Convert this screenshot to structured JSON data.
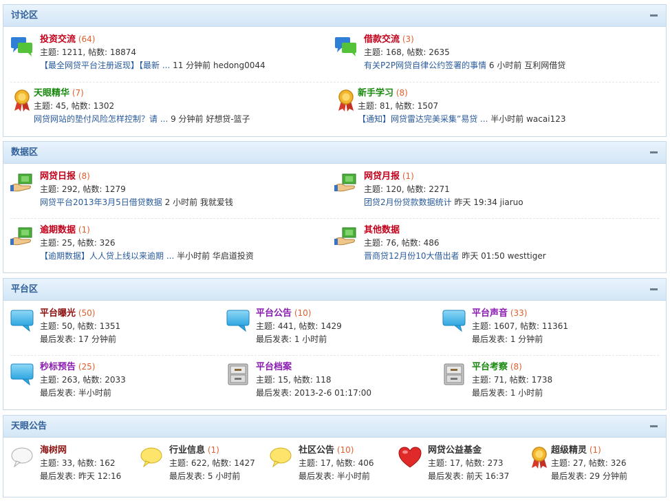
{
  "sections": [
    {
      "title": "讨论区",
      "forums": [
        {
          "name": "投资交流",
          "count": "(64)",
          "stats": "主题: 1211, 帖数: 18874",
          "last_link": "【最全网贷平台注册返现】【最新 ...",
          "last_meta": " 11 分钟前 hedong0044",
          "icon": "chat-bubbles-icon"
        },
        {
          "name": "借款交流",
          "count": "(3)",
          "stats": "主题: 168, 帖数: 2635",
          "last_link": "有关P2P网贷自律公约签署的事情",
          "last_meta": " 6 小时前 互利网借贷",
          "icon": "chat-bubbles-icon"
        },
        {
          "name": "天眼精华",
          "count": "(7)",
          "stats": "主题: 45, 帖数: 1302",
          "last_link": "网贷网站的垫付风险怎样控制？请 ...",
          "last_meta": " 9 分钟前 好想贷-篮子",
          "icon": "medal-icon"
        },
        {
          "name": "新手学习",
          "count": "(8)",
          "stats": "主题: 81, 帖数: 1507",
          "last_link": "【通知】网贷雷达完美采集”易贷 ...",
          "last_meta": " 半小时前 wacai123",
          "icon": "medal-icon"
        }
      ]
    },
    {
      "title": "数据区",
      "forums": [
        {
          "name": "网贷日报",
          "count": "(8)",
          "stats": "主题: 292, 帖数: 1279",
          "last_link": "网贷平台2013年3月5日借贷数据",
          "last_meta": " 2 小时前 我就爱钱",
          "icon": "money-hand-icon"
        },
        {
          "name": "网贷月报",
          "count": "(1)",
          "stats": "主题: 120, 帖数: 2271",
          "last_link": "团贷2月份贷款数据统计",
          "last_meta": " 昨天 19:34 jiaruo",
          "icon": "money-hand-icon"
        },
        {
          "name": "逾期数据",
          "count": "(1)",
          "stats": "主题: 25, 帖数: 326",
          "last_link": "【逾期数据】人人贷上线以来逾期 ...",
          "last_meta": " 半小时前 华启道投资",
          "icon": "money-hand-icon"
        },
        {
          "name": "其他数据",
          "count": "",
          "stats": "主题: 76, 帖数: 486",
          "last_link": "晋商贷12月份10大借出者",
          "last_meta": " 昨天 01:50 westtiger",
          "icon": "money-hand-icon"
        }
      ]
    },
    {
      "title": "平台区",
      "forums": [
        {
          "name": "平台曝光",
          "count": "(50)",
          "stats": "主题: 50, 帖数: 1351",
          "last_post": "最后发表: 17 分钟前",
          "icon": "speech-bubble-icon"
        },
        {
          "name": "平台公告",
          "count": "(10)",
          "stats": "主题: 441, 帖数: 1429",
          "last_post": "最后发表: 1 小时前",
          "icon": "speech-bubble-icon"
        },
        {
          "name": "平台声音",
          "count": "(33)",
          "stats": "主题: 1607, 帖数: 11361",
          "last_post": "最后发表: 1 分钟前",
          "icon": "speech-bubble-icon"
        },
        {
          "name": "秒标预告",
          "count": "(25)",
          "stats": "主题: 263, 帖数: 2033",
          "last_post": "最后发表: 半小时前",
          "icon": "speech-bubble-icon"
        },
        {
          "name": "平台档案",
          "count": "",
          "stats": "主题: 15, 帖数: 118",
          "last_post": "最后发表: 2013-2-6 01:17:00",
          "icon": "archive-box-icon"
        },
        {
          "name": "平台考察",
          "count": "(8)",
          "stats": "主题: 71, 帖数: 1738",
          "last_post": "最后发表: 1 小时前",
          "icon": "archive-box-icon"
        }
      ]
    },
    {
      "title": "天眼公告",
      "forums": [
        {
          "name": "海树网",
          "count": "",
          "stats": "主题: 33, 帖数: 162",
          "last_post": "最后发表: 昨天 12:16",
          "icon": "white-bubble-icon"
        },
        {
          "name": "行业信息",
          "count": "(1)",
          "stats": "主题: 622, 帖数: 1427",
          "last_post": "最后发表: 5 小时前",
          "icon": "yellow-bubble-icon"
        },
        {
          "name": "社区公告",
          "count": "(10)",
          "stats": "主题: 17, 帖数: 406",
          "last_post": "最后发表: 半小时前",
          "icon": "yellow-bubble-icon"
        },
        {
          "name": "网贷公益基金",
          "count": "",
          "stats": "主题: 17, 帖数: 273",
          "last_post": "最后发表: 前天 16:37",
          "icon": "heart-icon"
        },
        {
          "name": "超级精灵",
          "count": "(1)",
          "stats": "主题: 27, 帖数: 326",
          "last_post": "最后发表: 29 分钟前",
          "icon": "medal-icon"
        }
      ]
    }
  ]
}
